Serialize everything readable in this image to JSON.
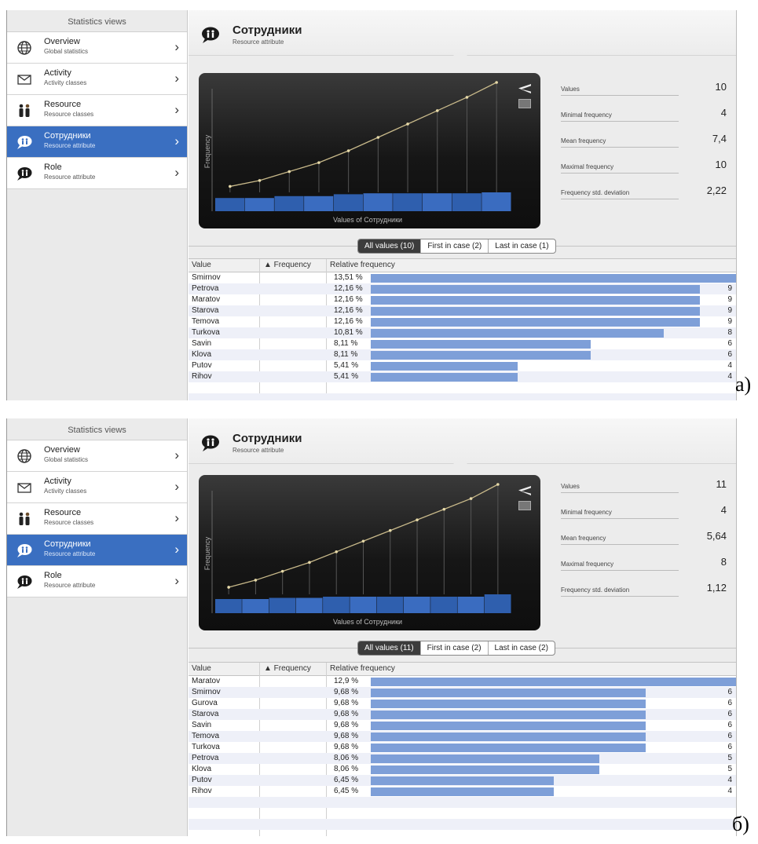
{
  "sidebar": {
    "title": "Statistics views",
    "items": [
      {
        "label": "Overview",
        "sub": "Global statistics",
        "icon": "globe-icon"
      },
      {
        "label": "Activity",
        "sub": "Activity classes",
        "icon": "envelope-icon"
      },
      {
        "label": "Resource",
        "sub": "Resource classes",
        "icon": "people-icon"
      },
      {
        "label": "Сотрудники",
        "sub": "Resource attribute",
        "icon": "speech-people-icon"
      },
      {
        "label": "Role",
        "sub": "Resource attribute",
        "icon": "speech-people-icon"
      }
    ]
  },
  "header": {
    "title": "Сотрудники",
    "subtitle": "Resource attribute"
  },
  "stat_labels": [
    "Values",
    "Minimal frequency",
    "Mean frequency",
    "Maximal frequency",
    "Frequency std. deviation"
  ],
  "chart_labels": {
    "ylabel": "Frequency",
    "xlabel": "Values of Сотрудники"
  },
  "table_headers": {
    "value": "Value",
    "frequency": "▲ Frequency",
    "relative": "Relative frequency"
  },
  "colors": {
    "accent": "#3a6fc1",
    "bar": "#7e9fd8",
    "line": "#c8b98a"
  },
  "panels": [
    {
      "label": "а)",
      "stats": [
        "10",
        "4",
        "7,4",
        "10",
        "2,22"
      ],
      "tabs": [
        "All values (10)",
        "First in case (2)",
        "Last in case (1)"
      ],
      "rows": [
        {
          "value": "Smirnov",
          "freq": "10",
          "rel": "13,51 %"
        },
        {
          "value": "Petrova",
          "freq": "9",
          "rel": "12,16 %"
        },
        {
          "value": "Maratov",
          "freq": "9",
          "rel": "12,16 %"
        },
        {
          "value": "Starova",
          "freq": "9",
          "rel": "12,16 %"
        },
        {
          "value": "Temova",
          "freq": "9",
          "rel": "12,16 %"
        },
        {
          "value": "Turkova",
          "freq": "8",
          "rel": "10,81 %"
        },
        {
          "value": "Savin",
          "freq": "6",
          "rel": "8,11 %"
        },
        {
          "value": "Klova",
          "freq": "6",
          "rel": "8,11 %"
        },
        {
          "value": "Putov",
          "freq": "4",
          "rel": "5,41 %"
        },
        {
          "value": "Rihov",
          "freq": "4",
          "rel": "5,41 %"
        }
      ]
    },
    {
      "label": "б)",
      "stats": [
        "11",
        "4",
        "5,64",
        "8",
        "1,12"
      ],
      "tabs": [
        "All values (11)",
        "First in case (2)",
        "Last in case (2)"
      ],
      "rows": [
        {
          "value": "Maratov",
          "freq": "8",
          "rel": "12,9 %"
        },
        {
          "value": "Smirnov",
          "freq": "6",
          "rel": "9,68 %"
        },
        {
          "value": "Gurova",
          "freq": "6",
          "rel": "9,68 %"
        },
        {
          "value": "Starova",
          "freq": "6",
          "rel": "9,68 %"
        },
        {
          "value": "Savin",
          "freq": "6",
          "rel": "9,68 %"
        },
        {
          "value": "Temova",
          "freq": "6",
          "rel": "9,68 %"
        },
        {
          "value": "Turkova",
          "freq": "6",
          "rel": "9,68 %"
        },
        {
          "value": "Petrova",
          "freq": "5",
          "rel": "8,06 %"
        },
        {
          "value": "Klova",
          "freq": "5",
          "rel": "8,06 %"
        },
        {
          "value": "Putov",
          "freq": "4",
          "rel": "6,45 %"
        },
        {
          "value": "Rihov",
          "freq": "4",
          "rel": "6,45 %"
        }
      ]
    }
  ]
}
